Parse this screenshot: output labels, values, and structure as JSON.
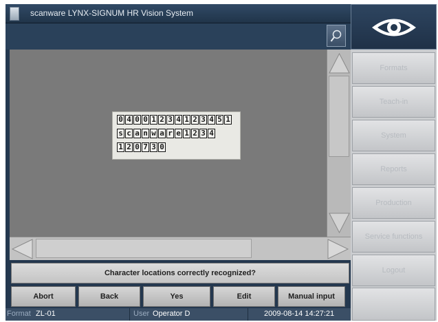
{
  "app": {
    "title": "scanware LYNX-SIGNUM HR Vision System",
    "logo": "eye-icon"
  },
  "toolbar": {
    "search_icon": "magnifier-icon"
  },
  "sample_text": {
    "rows": [
      [
        "0",
        "4",
        "0",
        "0",
        "1",
        "2",
        "3",
        "4",
        "1",
        "2",
        "3",
        "4",
        "5",
        "1"
      ],
      [
        "s",
        "c",
        "a",
        "n",
        "w",
        "a",
        "r",
        "e",
        "1",
        "2",
        "3",
        "4"
      ],
      [
        "1",
        "2",
        "0",
        "7",
        "3",
        "0"
      ]
    ]
  },
  "prompt": "Character locations correctly recognized?",
  "actions": [
    {
      "label": "Abort"
    },
    {
      "label": "Back"
    },
    {
      "label": "Yes"
    },
    {
      "label": "Edit"
    },
    {
      "label": "Manual input"
    }
  ],
  "status": {
    "format_label": "Format",
    "format_value": "ZL-01",
    "user_label": "User",
    "user_value": "Operator D",
    "datetime": "2009-08-14 14:27:21"
  },
  "nav": [
    {
      "label": "Formats"
    },
    {
      "label": "Teach-in"
    },
    {
      "label": "System"
    },
    {
      "label": "Reports"
    },
    {
      "label": "Production"
    },
    {
      "label": "Service functions"
    },
    {
      "label": "Logout"
    }
  ],
  "colors": {
    "frame": "#24384f",
    "viewport": "#7a7a7a",
    "nav_disabled_text": "#b7bbc0"
  }
}
